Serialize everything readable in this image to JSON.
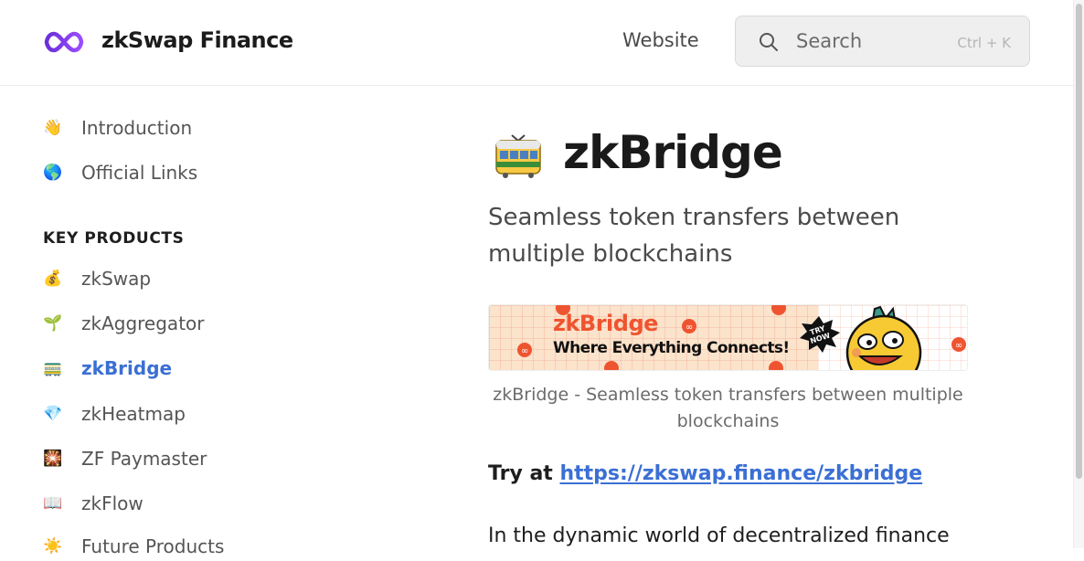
{
  "header": {
    "site_title": "zkSwap Finance",
    "website_link": "Website",
    "search": {
      "label": "Search",
      "shortcut": "Ctrl + K"
    }
  },
  "sidebar": {
    "top_items": [
      {
        "label": "Introduction",
        "emoji": "👋"
      },
      {
        "label": "Official Links",
        "emoji": "🌎"
      }
    ],
    "section_title": "KEY PRODUCTS",
    "products": [
      {
        "label": "zkSwap",
        "emoji": "💰"
      },
      {
        "label": "zkAggregator",
        "emoji": "🌱"
      },
      {
        "label": "zkBridge",
        "emoji": "🚃",
        "active": true
      },
      {
        "label": "zkHeatmap",
        "emoji": "💎"
      },
      {
        "label": "ZF Paymaster",
        "emoji": "🎇"
      },
      {
        "label": "zkFlow",
        "emoji": "📖"
      },
      {
        "label": "Future Products",
        "emoji": "☀️"
      }
    ]
  },
  "content": {
    "title": "zkBridge",
    "subtitle": "Seamless token transfers between multiple blockchains",
    "banner": {
      "brand": "zkBridge",
      "tagline": "Where Everything Connects!",
      "badge": "TRY NOW!"
    },
    "caption": "zkBridge - Seamless token transfers between multiple blockchains",
    "try_prefix": "Try at ",
    "try_link": "https://zkswap.finance/zkbridge",
    "paragraph_start": "In the dynamic world of decentralized finance"
  },
  "colors": {
    "accent": "#3b6fd4",
    "logo": "#7b3fe4",
    "banner_orange": "#ef5430",
    "banner_bg": "#fbe3cc"
  }
}
